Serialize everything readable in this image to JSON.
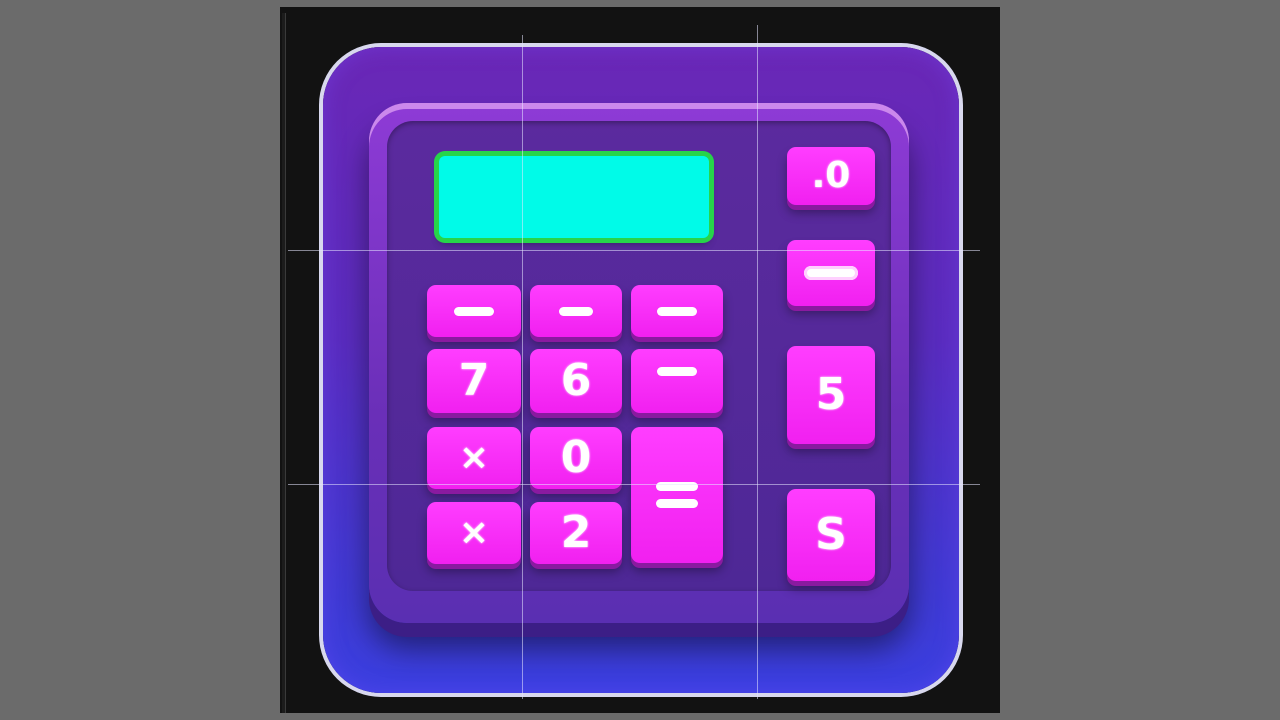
{
  "colors": {
    "background": "#6b6b6b",
    "frame": "#121212",
    "tile_top": "#6a27b6",
    "tile_bottom": "#3a3fe0",
    "display": "#00fbe8",
    "display_border": "#27d44a",
    "key": "#f120f0",
    "key_text": "#ffffff"
  },
  "calculator": {
    "display_text": "",
    "keys": {
      "r1c1": "",
      "r1c2": "",
      "r1c3": "",
      "r2c1": "7",
      "r2c2": "6",
      "r2c3": "",
      "r3c1": "×",
      "r3c2": "0",
      "r4c1": "×",
      "r4c2": "2",
      "equals": "",
      "side1": ".0",
      "side2": "",
      "side3": "5",
      "side4": "S"
    }
  }
}
